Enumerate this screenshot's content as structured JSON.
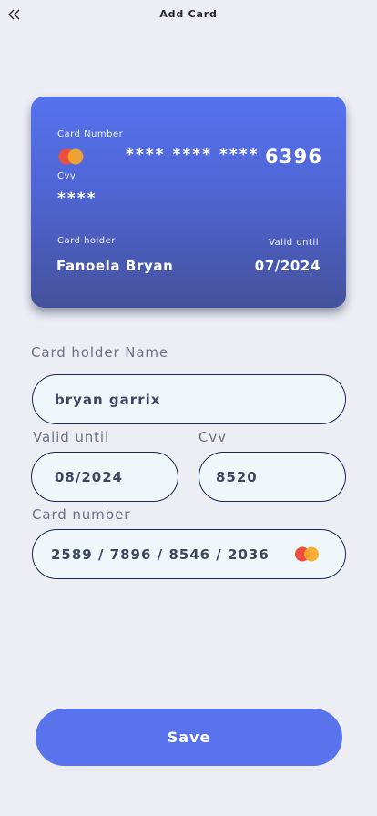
{
  "header": {
    "title": "Add Card",
    "back_icon": "double-chevron-left-icon"
  },
  "card_preview": {
    "number_label": "Card Number",
    "number_masked": "**** **** ****",
    "number_last4": "6396",
    "cvv_label": "Cvv",
    "cvv_masked": "****",
    "holder_label": "Card holder",
    "holder_name": "Fanoela Bryan",
    "valid_label": "Valid until",
    "valid_value": "07/2024",
    "brand_icon": "mastercard-icon"
  },
  "form": {
    "holder_label": "Card holder Name",
    "holder_value": "bryan garrix",
    "valid_label": "Valid until",
    "valid_value": "08/2024",
    "cvv_label": "Cvv",
    "cvv_value": "8520",
    "number_label": "Card number",
    "number_value": "2589 / 7896 / 8546 / 2036",
    "brand_icon": "mastercard-icon"
  },
  "actions": {
    "save_label": "Save"
  },
  "colors": {
    "background": "#edeef4",
    "card_gradient_top": "#5572ee",
    "card_gradient_bottom": "#44529b",
    "field_border": "#1d2552",
    "field_fill": "#f0f7fb",
    "save_button": "#5873ec",
    "mastercard_red": "#eb4d3f",
    "mastercard_orange": "#f7a82a"
  }
}
